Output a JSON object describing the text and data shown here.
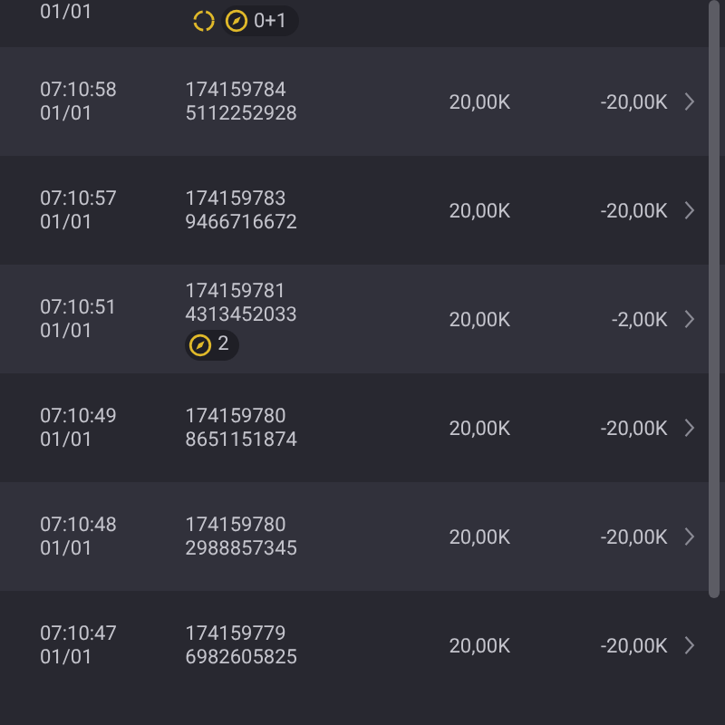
{
  "partial_row": {
    "date": "01/01",
    "badges": [
      {
        "kind": "sync"
      },
      {
        "kind": "bonus",
        "text": "0+1"
      }
    ]
  },
  "rows": [
    {
      "time": "07:10:58",
      "date": "01/01",
      "ids": [
        "174159784",
        "5112252928"
      ],
      "stake": "20,00K",
      "result": "-20,00K",
      "badges": []
    },
    {
      "time": "07:10:57",
      "date": "01/01",
      "ids": [
        "174159783",
        "9466716672"
      ],
      "stake": "20,00K",
      "result": "-20,00K",
      "badges": []
    },
    {
      "time": "07:10:51",
      "date": "01/01",
      "ids": [
        "174159781",
        "4313452033"
      ],
      "stake": "20,00K",
      "result": "-2,00K",
      "badges": [
        {
          "kind": "bonus",
          "text": "2"
        }
      ]
    },
    {
      "time": "07:10:49",
      "date": "01/01",
      "ids": [
        "174159780",
        "8651151874"
      ],
      "stake": "20,00K",
      "result": "-20,00K",
      "badges": []
    },
    {
      "time": "07:10:48",
      "date": "01/01",
      "ids": [
        "174159780",
        "2988857345"
      ],
      "stake": "20,00K",
      "result": "-20,00K",
      "badges": []
    },
    {
      "time": "07:10:47",
      "date": "01/01",
      "ids": [
        "174159779",
        "6982605825"
      ],
      "stake": "20,00K",
      "result": "-20,00K",
      "badges": []
    }
  ]
}
